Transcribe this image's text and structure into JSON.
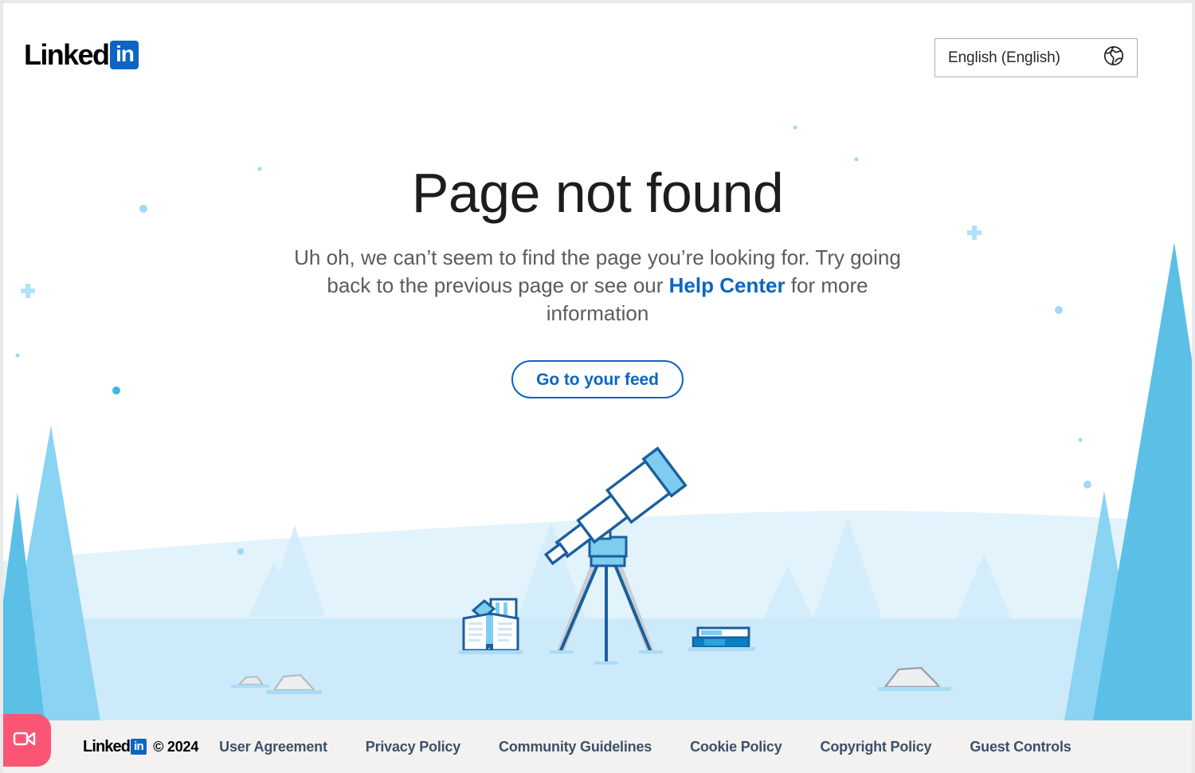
{
  "header": {
    "logo": {
      "word": "Linked",
      "box": "in",
      "name": "linkedin-logo"
    },
    "language_selector": {
      "value": "English (English)",
      "icon": "globe-icon"
    }
  },
  "main": {
    "title": "Page not found",
    "description_part1": "Uh oh, we can’t seem to find the page you’re looking for. Try going back to the previous page or see our ",
    "help_center_link": "Help Center",
    "description_part2": " for more information",
    "cta_button": "Go to your feed"
  },
  "illustration": {
    "name": "telescope-snow-scene-illustration",
    "objects": [
      "telescope",
      "tripod",
      "open-book",
      "stacked-books",
      "pine-trees",
      "rocks",
      "snow-hills",
      "sparkles"
    ],
    "colors": {
      "outline_blue": "#0a66c2",
      "fill_light_blue": "#7ecdf0",
      "pale_blue": "#d7eefb",
      "ground_blue": "#cdeafa",
      "tree_blue": "#7ecdf0",
      "tree_pale": "#d4edfb",
      "rock_gray": "#e8eaed"
    }
  },
  "footer": {
    "brand": {
      "word": "Linked",
      "box": "in"
    },
    "copyright": "© 2024",
    "links": [
      "User Agreement",
      "Privacy Policy",
      "Community Guidelines",
      "Cookie Policy",
      "Copyright Policy",
      "Guest Controls"
    ]
  },
  "overlay": {
    "recording_badge": {
      "icon": "video-camera-icon",
      "color": "#fb5576"
    }
  },
  "colors": {
    "accent": "#0a66c2",
    "page_bg": "#ffffff",
    "footer_bg": "#f3f2f0",
    "text_primary": "#1d1d1d",
    "text_secondary": "#5b5b5b",
    "footer_link": "#3c5169"
  }
}
